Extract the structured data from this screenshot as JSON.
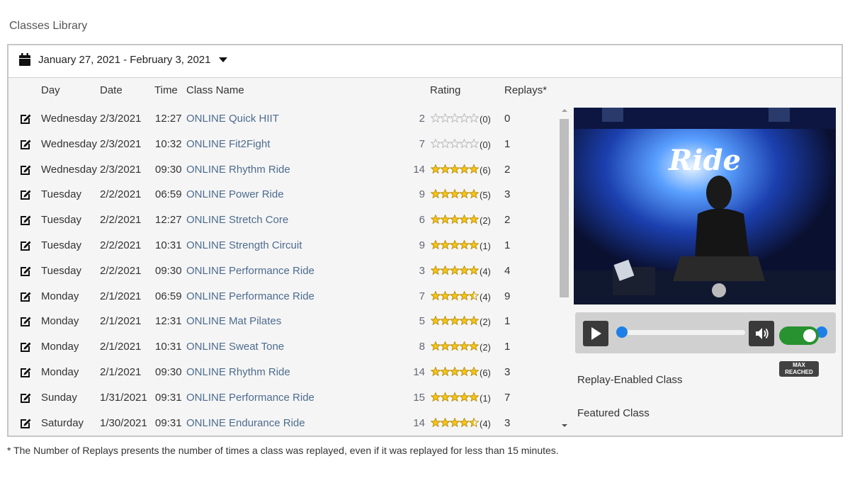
{
  "page": {
    "title": "Classes Library"
  },
  "date_filter": {
    "label": "January 27, 2021 - February 3, 2021"
  },
  "columns": {
    "day": "Day",
    "date": "Date",
    "time": "Time",
    "name": "Class Name",
    "rating": "Rating",
    "replays": "Replays*"
  },
  "classes": [
    {
      "day": "Wednesday",
      "date": "2/3/2021",
      "time": "12:27",
      "name": "ONLINE Quick HIIT",
      "count": "2",
      "stars": 0,
      "rating_count": "(0)",
      "replays": "0"
    },
    {
      "day": "Wednesday",
      "date": "2/3/2021",
      "time": "10:32",
      "name": "ONLINE Fit2Fight",
      "count": "7",
      "stars": 0,
      "rating_count": "(0)",
      "replays": "1"
    },
    {
      "day": "Wednesday",
      "date": "2/3/2021",
      "time": "09:30",
      "name": "ONLINE Rhythm Ride",
      "count": "14",
      "stars": 5,
      "rating_count": "(6)",
      "replays": "2"
    },
    {
      "day": "Tuesday",
      "date": "2/2/2021",
      "time": "06:59",
      "name": "ONLINE Power Ride",
      "count": "9",
      "stars": 5,
      "rating_count": "(5)",
      "replays": "3"
    },
    {
      "day": "Tuesday",
      "date": "2/2/2021",
      "time": "12:27",
      "name": "ONLINE Stretch Core",
      "count": "6",
      "stars": 5,
      "rating_count": "(2)",
      "replays": "2"
    },
    {
      "day": "Tuesday",
      "date": "2/2/2021",
      "time": "10:31",
      "name": "ONLINE Strength Circuit",
      "count": "9",
      "stars": 5,
      "rating_count": "(1)",
      "replays": "1"
    },
    {
      "day": "Tuesday",
      "date": "2/2/2021",
      "time": "09:30",
      "name": "ONLINE Performance Ride",
      "count": "3",
      "stars": 5,
      "rating_count": "(4)",
      "replays": "4"
    },
    {
      "day": "Monday",
      "date": "2/1/2021",
      "time": "06:59",
      "name": "ONLINE Performance Ride",
      "count": "7",
      "stars": 4.5,
      "rating_count": "(4)",
      "replays": "9"
    },
    {
      "day": "Monday",
      "date": "2/1/2021",
      "time": "12:31",
      "name": "ONLINE Mat Pilates",
      "count": "5",
      "stars": 5,
      "rating_count": "(2)",
      "replays": "1"
    },
    {
      "day": "Monday",
      "date": "2/1/2021",
      "time": "10:31",
      "name": "ONLINE Sweat Tone",
      "count": "8",
      "stars": 5,
      "rating_count": "(2)",
      "replays": "1"
    },
    {
      "day": "Monday",
      "date": "2/1/2021",
      "time": "09:30",
      "name": "ONLINE Rhythm Ride",
      "count": "14",
      "stars": 5,
      "rating_count": "(6)",
      "replays": "3"
    },
    {
      "day": "Sunday",
      "date": "1/31/2021",
      "time": "09:31",
      "name": "ONLINE Performance Ride",
      "count": "15",
      "stars": 5,
      "rating_count": "(1)",
      "replays": "7"
    },
    {
      "day": "Saturday",
      "date": "1/30/2021",
      "time": "09:31",
      "name": "ONLINE Endurance Ride",
      "count": "14",
      "stars": 4.5,
      "rating_count": "(4)",
      "replays": "3"
    }
  ],
  "video": {
    "logo_text": "Ride"
  },
  "player": {
    "progress": 0.0,
    "volume": 0.9
  },
  "options": {
    "replay_enabled_label": "Replay-Enabled Class",
    "replay_enabled_on": true,
    "featured_label": "Featured Class",
    "featured_badge_line1": "MAX",
    "featured_badge_line2": "REACHED"
  },
  "footnote": "* The Number of Replays presents the number of times a class was replayed, even if it was replayed for less than 15 minutes.",
  "colors": {
    "star": "#f5c518",
    "star_empty": "#b5b5b5",
    "link": "#4d6c8e",
    "toggle": "#27922f",
    "accent": "#1e7fe8"
  }
}
